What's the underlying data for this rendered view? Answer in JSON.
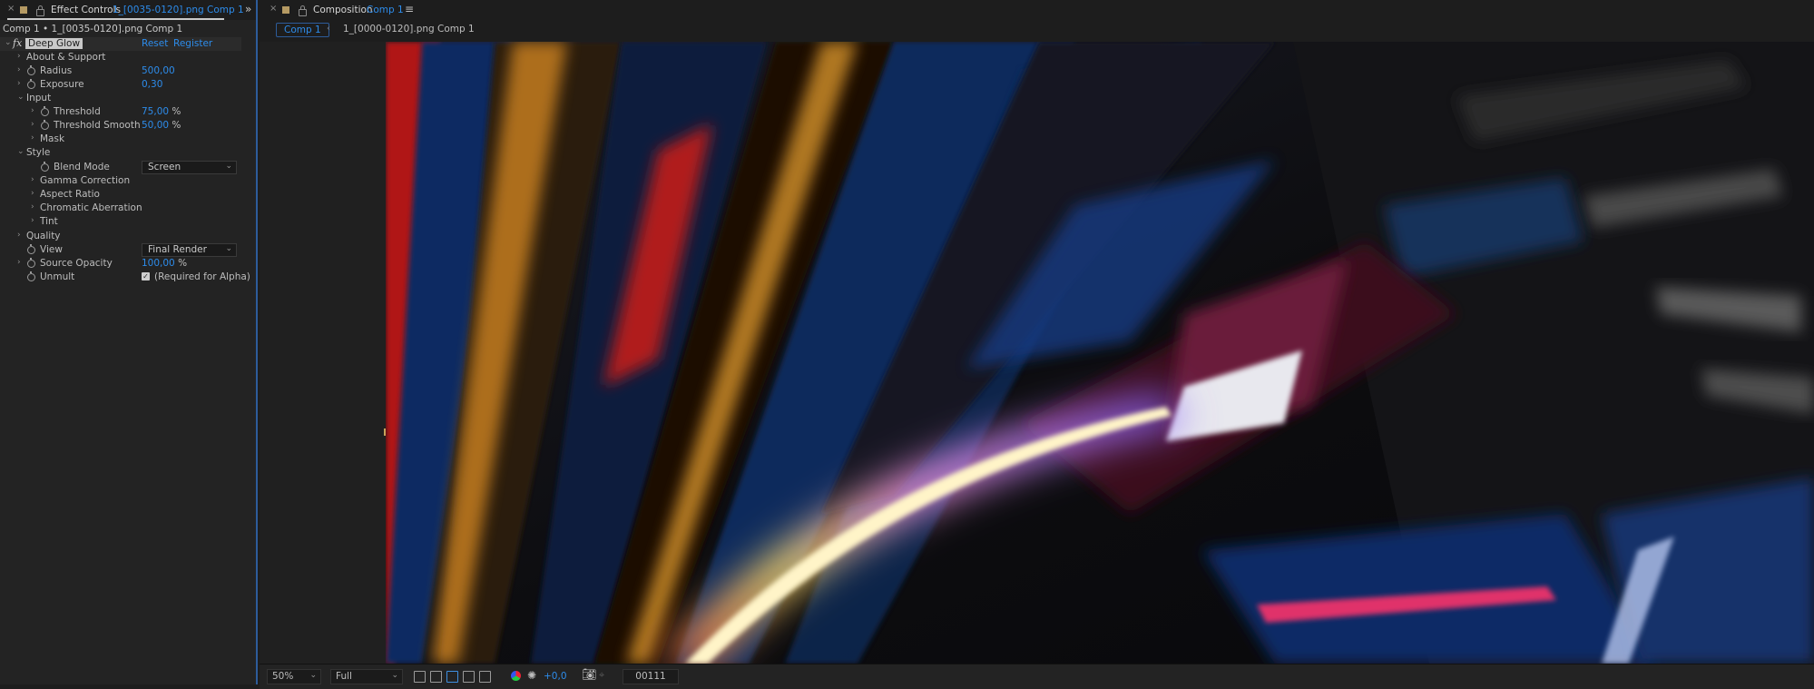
{
  "effect_controls": {
    "tab_title": "Effect Controls",
    "tab_subtitle": "1_[0035-0120].png Comp 1",
    "layer_path": "Comp 1 • 1_[0035-0120].png Comp 1",
    "effect": {
      "badge": "fx",
      "name": "Deep Glow",
      "reset": "Reset",
      "register": "Register"
    },
    "rows": {
      "about": "About & Support",
      "radius_label": "Radius",
      "radius_value": "500,00",
      "exposure_label": "Exposure",
      "exposure_value": "0,30",
      "input_group": "Input",
      "threshold_label": "Threshold",
      "threshold_value": "75,00",
      "threshold_unit": "%",
      "threshold_smooth_label": "Threshold Smooth",
      "threshold_smooth_value": "50,00",
      "threshold_smooth_unit": "%",
      "mask": "Mask",
      "style_group": "Style",
      "blend_mode_label": "Blend Mode",
      "blend_mode_value": "Screen",
      "gamma": "Gamma Correction",
      "aspect": "Aspect Ratio",
      "chromatic": "Chromatic Aberration",
      "tint": "Tint",
      "quality": "Quality",
      "view_label": "View",
      "view_value": "Final Render",
      "source_opacity_label": "Source Opacity",
      "source_opacity_value": "100,00",
      "source_opacity_unit": "%",
      "unmult_label": "Unmult",
      "unmult_checked": true,
      "unmult_note": "(Required for Alpha)"
    }
  },
  "composition": {
    "tab_title": "Composition",
    "tab_subtitle": "Comp 1",
    "breadcrumb_comp": "Comp 1",
    "breadcrumb_layer": "1_[0000-0120].png Comp 1"
  },
  "toolbar": {
    "zoom": "50%",
    "resolution": "Full",
    "exposure": "+0,0",
    "frame": "00111"
  },
  "colors": {
    "accent": "#2d8ceb",
    "panel_bg": "#232323"
  },
  "icons": [
    "close-icon",
    "lock-icon",
    "color-swatch-icon",
    "menu-icon",
    "panel-expand-icon",
    "chevron-right-icon",
    "chevron-down-icon",
    "stopwatch-icon",
    "checkbox-icon",
    "camera-icon"
  ]
}
